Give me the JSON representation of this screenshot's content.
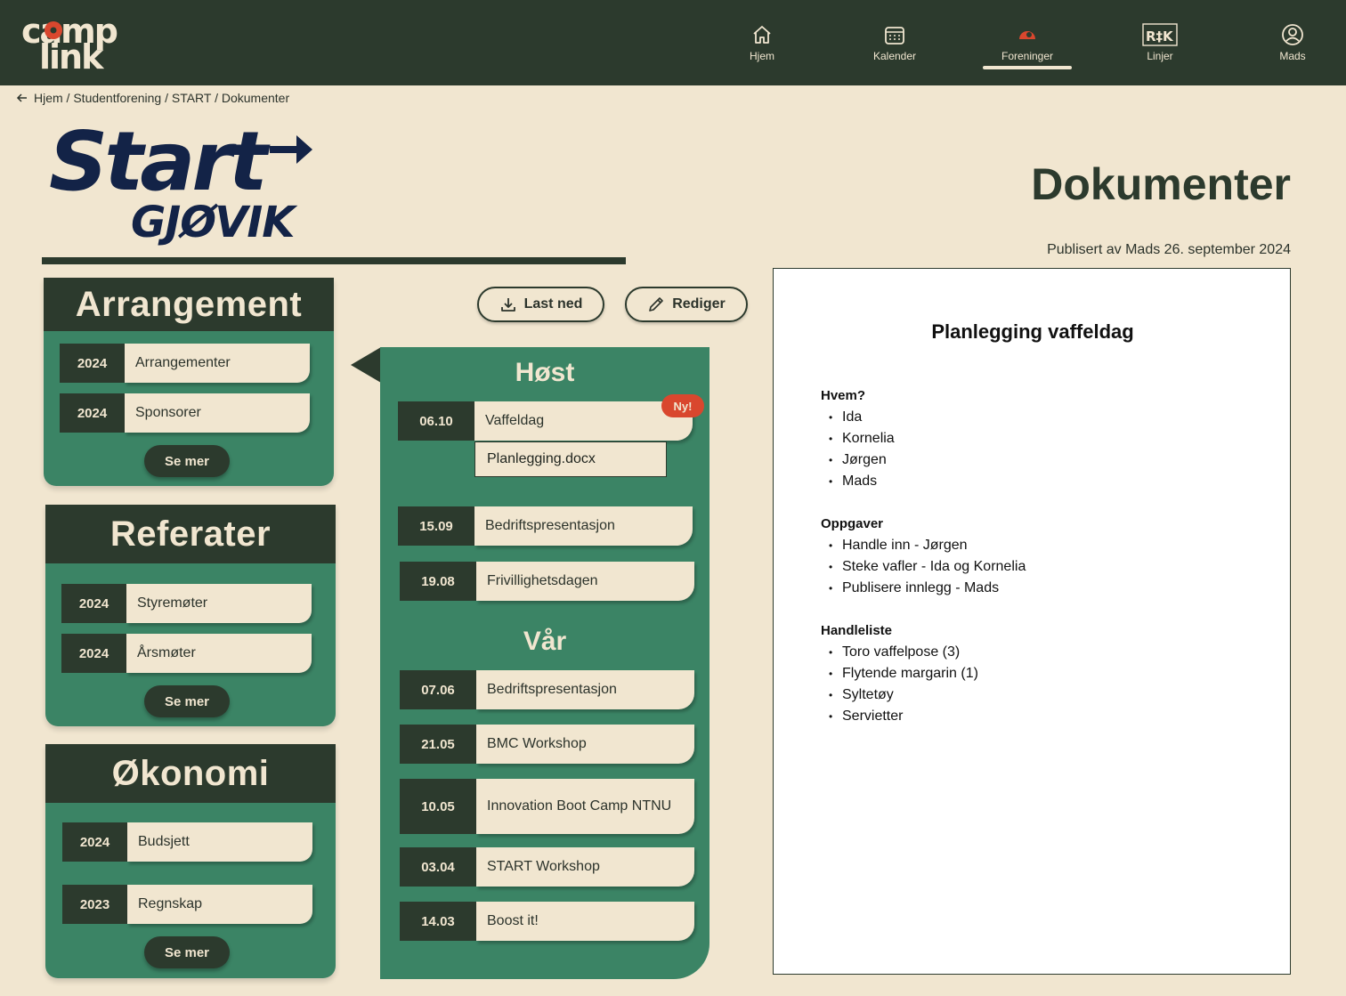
{
  "app": {
    "logo_text": "camp link"
  },
  "nav": {
    "items": [
      {
        "label": "Hjem",
        "icon": "home-icon"
      },
      {
        "label": "Kalender",
        "icon": "calendar-icon"
      },
      {
        "label": "Foreninger",
        "icon": "organizations-icon",
        "active": true
      },
      {
        "label": "Linjer",
        "icon": "lines-icon"
      },
      {
        "label": "Mads",
        "icon": "user-icon"
      }
    ]
  },
  "breadcrumb": {
    "text": "Hjem / Studentforening / START / Dokumenter"
  },
  "organization": {
    "logo_line1": "Start",
    "logo_line2": "GJØVIK"
  },
  "categories": [
    {
      "title": "Arrangement",
      "rows": [
        {
          "year": "2024",
          "label": "Arrangementer"
        },
        {
          "year": "2024",
          "label": "Sponsorer"
        }
      ],
      "more_label": "Se mer"
    },
    {
      "title": "Referater",
      "rows": [
        {
          "year": "2024",
          "label": "Styremøter"
        },
        {
          "year": "2024",
          "label": "Årsmøter"
        }
      ],
      "more_label": "Se mer"
    },
    {
      "title": "Økonomi",
      "rows": [
        {
          "year": "2024",
          "label": "Budsjett"
        },
        {
          "year": "2023",
          "label": "Regnskap"
        }
      ],
      "more_label": "Se mer"
    }
  ],
  "actions": {
    "download_label": "Last ned",
    "edit_label": "Rediger"
  },
  "timeline": {
    "seasons": [
      {
        "name": "Høst",
        "events": [
          {
            "date": "06.10",
            "title": "Vaffeldag",
            "badge": "Ny!",
            "file": "Planlegging.docx"
          },
          {
            "date": "15.09",
            "title": "Bedriftspresentasjon"
          },
          {
            "date": "19.08",
            "title": "Frivillighetsdagen"
          }
        ]
      },
      {
        "name": "Vår",
        "events": [
          {
            "date": "07.06",
            "title": "Bedriftspresentasjon"
          },
          {
            "date": "21.05",
            "title": "BMC Workshop"
          },
          {
            "date": "10.05",
            "title": "Innovation Boot Camp NTNU"
          },
          {
            "date": "03.04",
            "title": "START Workshop"
          },
          {
            "date": "14.03",
            "title": "Boost it!"
          }
        ]
      }
    ]
  },
  "page": {
    "title": "Dokumenter",
    "published": "Publisert av Mads 26. september 2024"
  },
  "document": {
    "title": "Planlegging vaffeldag",
    "sections": [
      {
        "heading": "Hvem?",
        "items": [
          "Ida",
          "Kornelia",
          "Jørgen",
          "Mads"
        ]
      },
      {
        "heading": "Oppgaver",
        "items": [
          "Handle inn - Jørgen",
          "Steke vafler - Ida og Kornelia",
          "Publisere innlegg - Mads"
        ]
      },
      {
        "heading": "Handleliste",
        "items": [
          "Toro vaffelpose (3)",
          "Flytende margarin (1)",
          "Syltetøy",
          "Servietter"
        ]
      }
    ]
  },
  "colors": {
    "dark": "#2c3a2d",
    "green": "#3b8465",
    "cream": "#f1e6d0",
    "accent": "#d9472e"
  }
}
